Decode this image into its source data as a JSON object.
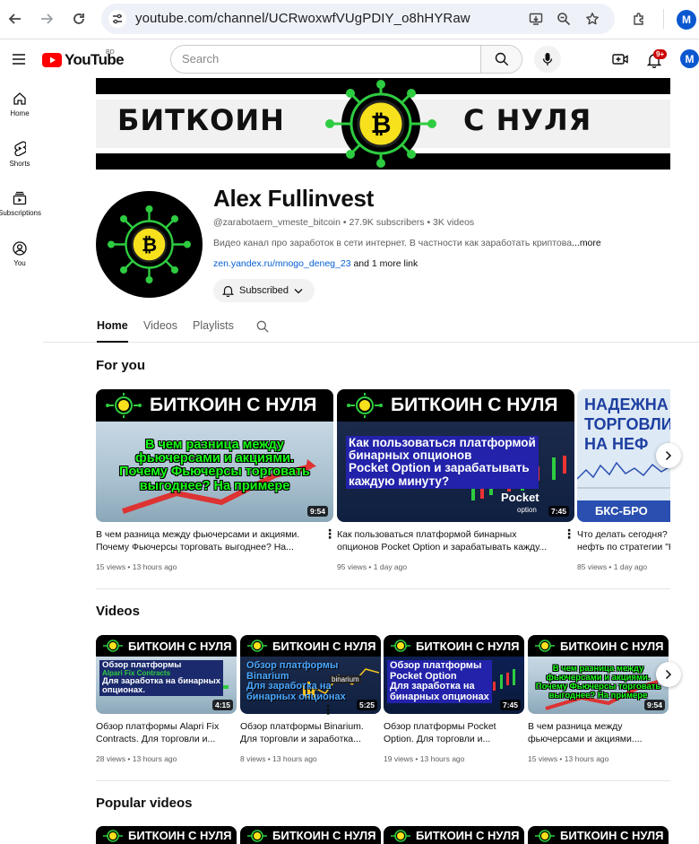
{
  "browser": {
    "url": "youtube.com/channel/UCRwoxwfVUgPDIY_o8hHYRaw",
    "profile_initial": "M"
  },
  "header": {
    "logo_text": "YouTube",
    "logo_region": "BD",
    "search_placeholder": "Search",
    "notifications_badge": "9+",
    "avatar_initial": "M"
  },
  "sidebar": {
    "items": [
      {
        "label": "Home",
        "icon": "home-icon"
      },
      {
        "label": "Shorts",
        "icon": "shorts-icon"
      },
      {
        "label": "Subscriptions",
        "icon": "subscriptions-icon"
      },
      {
        "label": "You",
        "icon": "you-icon"
      }
    ]
  },
  "banner": {
    "left_text": "БИТКОИН",
    "right_text": "С НУЛЯ"
  },
  "channel": {
    "name": "Alex Fullinvest",
    "handle_line": "@zarabotaem_vmeste_bitcoin • 27.9K subscribers • 3K videos",
    "description": "Видео канал про заработок в сети интернет. В частности как заработать криптова",
    "more": "...more",
    "link": "zen.yandex.ru/mnogo_deneg_23",
    "link_more": "and 1 more link",
    "subscribe_label": "Subscribed"
  },
  "tabs": [
    "Home",
    "Videos",
    "Playlists"
  ],
  "sections": {
    "for_you": {
      "title": "For you",
      "videos": [
        {
          "banner": "БИТКОИН С НУЛЯ",
          "overlay": [
            "В чем разница между",
            "фьючерсами и акциями.",
            "Почему Фьючерсы торговать",
            "выгоднее? На примере"
          ],
          "duration": "9:54",
          "title_lines": [
            "В чем разница между фьючерсами и акциями.",
            "Почему Фьючерсы торговать выгоднее? На..."
          ],
          "meta": "15 views • 13 hours ago"
        },
        {
          "banner": "БИТКОИН С НУЛЯ",
          "overlay": [
            "Как пользоваться платформой",
            "бинарных опционов",
            "Pocket Option и зарабатывать",
            "каждую минуту?"
          ],
          "logo": "Pocket",
          "logo_sub": "option",
          "duration": "7:45",
          "title_lines": [
            "Как пользоваться платформой бинарных",
            "опционов Pocket Option и зарабатывать кажду..."
          ],
          "meta": "95 views • 1 day ago"
        },
        {
          "banner_lines": [
            "НАДЕЖНА",
            "ТОРГОВЛИ",
            "НА НЕФ"
          ],
          "brand": "БКС-БРО",
          "title_lines": [
            "Что делать сегодня?",
            "нефть по стратегии \"Н"
          ],
          "meta": "85 views • 1 day ago"
        }
      ]
    },
    "videos": {
      "title": "Videos",
      "videos": [
        {
          "banner": "БИТКОИН С НУЛЯ",
          "overlay": [
            "Обзор платформы",
            "Alpari Fix Contracts",
            "Для заработка на бинарных",
            "опционах."
          ],
          "duration": "4:15",
          "title_lines": [
            "Обзор платформы Alapri Fix",
            "Contracts. Для торговли и..."
          ],
          "meta": "28 views • 13 hours ago"
        },
        {
          "banner": "БИТКОИН С НУЛЯ",
          "overlay": [
            "Обзор платформы",
            "Binarium",
            "Для заработка на",
            "бинарных опционах"
          ],
          "badge": "binarium",
          "duration": "5:25",
          "title_lines": [
            "Обзор платформы Binarium.",
            "Для торговли и заработка..."
          ],
          "meta": "8 views • 13 hours ago"
        },
        {
          "banner": "БИТКОИН С НУЛЯ",
          "overlay": [
            "Обзор платформы",
            "Pocket Option",
            "Для заработка на",
            "бинарных опционах"
          ],
          "duration": "7:45",
          "title_lines": [
            "Обзор платформы Pocket",
            "Option. Для торговли и..."
          ],
          "meta": "19 views • 13 hours ago"
        },
        {
          "banner": "БИТКОИН С НУЛЯ",
          "overlay": [
            "В чем разница между",
            "фьючерсами и акциями.",
            "Почему Фьючерсы торговать",
            "выгоднее? На примере"
          ],
          "duration": "9:54",
          "title_lines": [
            "В чем разница между",
            "фьючерсами и акциями...."
          ],
          "meta": "15 views • 13 hours ago"
        }
      ]
    },
    "popular": {
      "title": "Popular videos",
      "banner": "БИТКОИН С НУЛЯ"
    }
  }
}
